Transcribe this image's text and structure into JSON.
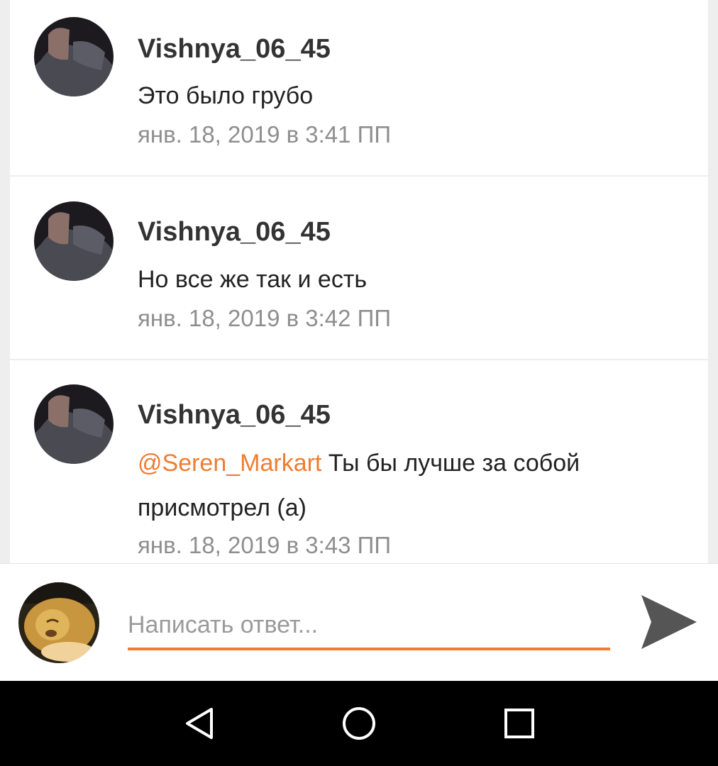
{
  "comments": [
    {
      "author": "Vishnya_06_45",
      "mention": "",
      "text": "Это было грубо",
      "time": "янв. 18, 2019 в 3:41 ПП"
    },
    {
      "author": "Vishnya_06_45",
      "mention": "",
      "text": "Но все же так и есть",
      "time": "янв. 18, 2019 в 3:42 ПП"
    },
    {
      "author": "Vishnya_06_45",
      "mention": "@Seren_Markart",
      "text": " Ты бы лучше за собой присмотрел (а)",
      "time": "янв. 18, 2019 в 3:43 ПП"
    }
  ],
  "reply": {
    "placeholder": "Написать ответ...",
    "value": ""
  },
  "icons": {
    "send": "send-icon",
    "back": "back-icon",
    "home": "home-icon",
    "recents": "recents-icon"
  },
  "colors": {
    "accent": "#f07c32",
    "timestamp": "#8e8e8e",
    "send_icon": "#555555",
    "navbar": "#000000"
  }
}
